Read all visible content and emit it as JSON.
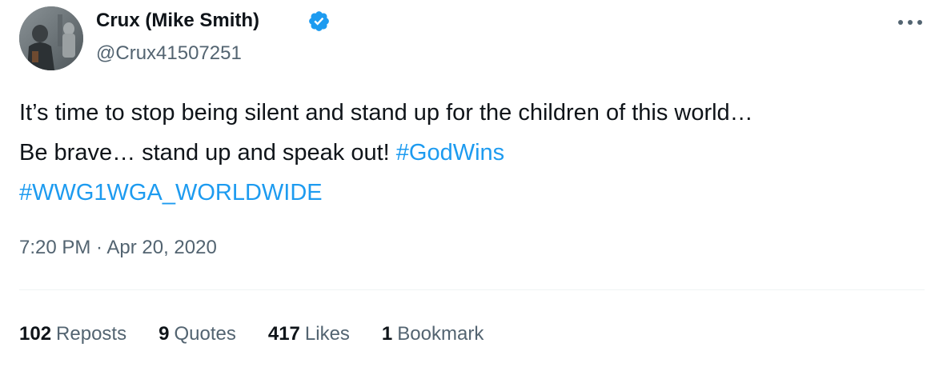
{
  "author": {
    "display_name": "Crux (Mike Smith)",
    "handle": "@Crux41507251",
    "verified_icon": "verified-badge-icon",
    "verified_color": "#1d9bf0"
  },
  "tweet": {
    "line1": "It’s time to stop being silent and stand up for the children of this world…",
    "line2_text": "Be brave… stand up and speak out! ",
    "hashtags": [
      "#GodWins",
      "#WWG1WGA_WORLDWIDE"
    ],
    "timestamp": "7:20 PM · Apr 20, 2020"
  },
  "stats": [
    {
      "count": "102",
      "label": "Reposts"
    },
    {
      "count": "9",
      "label": "Quotes"
    },
    {
      "count": "417",
      "label": "Likes"
    },
    {
      "count": "1",
      "label": "Bookmark"
    }
  ],
  "colors": {
    "text": "#0f1419",
    "secondary": "#536471",
    "link": "#1d9bf0",
    "divider": "#eff3f4"
  }
}
